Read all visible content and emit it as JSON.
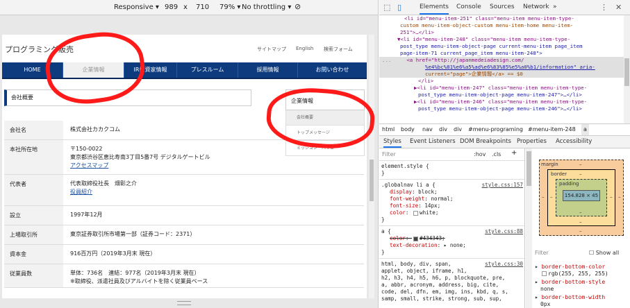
{
  "device_toolbar": {
    "mode": "Responsive",
    "width": "989",
    "times": "x",
    "height": "710",
    "zoom": "79%",
    "throttle": "No throttling"
  },
  "site": {
    "title": "プログラミング販売",
    "util_links": [
      "サイトマップ",
      "English",
      "検索フォーム"
    ],
    "nav": [
      "HOME",
      "企業情報",
      "IR投資家情報",
      "プレスルーム",
      "採用情報",
      "お問い合わせ"
    ],
    "section_heading": "会社概要",
    "side_menu": {
      "heading": "企業情報",
      "items": [
        "会社概要",
        "トップメッセージ",
        "ミッション・バリュー"
      ]
    },
    "table": [
      {
        "label": "会社名",
        "lines": [
          "株式会社カカクコム"
        ],
        "link": ""
      },
      {
        "label": "本社所在地",
        "lines": [
          "〒150-0022",
          "東京都渋谷区恵比寿南3丁目5番7号 デジタルゲートビル"
        ],
        "link": "アクセスマップ"
      },
      {
        "label": "代表者",
        "lines": [
          "代表取締役社長　畑彰之介"
        ],
        "link": "役員紹介"
      },
      {
        "label": "設立",
        "lines": [
          "1997年12月"
        ],
        "link": ""
      },
      {
        "label": "上場取引所",
        "lines": [
          "東京証券取引所市場第一部（証券コード：2371）"
        ],
        "link": ""
      },
      {
        "label": "資本金",
        "lines": [
          "916百万円（2019年3月末 現在）"
        ],
        "link": ""
      },
      {
        "label": "従業員数",
        "lines": [
          "単体：736名　連結：977名（2019年3月末 現在）",
          "※取締役、派遣社員及びアルバイトを除く従業員ベース"
        ],
        "link": ""
      }
    ]
  },
  "devtools": {
    "tabs": [
      "Elements",
      "Console",
      "Sources",
      "Network"
    ],
    "more": "»",
    "elements_lines": [
      "<li id=\"menu-item-251\" class=\"menu-item menu-item-type-",
      "custom menu-item-object-custom menu-item-home menu-item-",
      "251\">…</li>",
      "▼<li id=\"menu-item-248\" class=\"menu-item menu-item-type-",
      "post_type menu-item-object-page current-menu-item page_item",
      "page-item-71 current_page_item menu-item-248\">",
      "<a href=\"http://japanmedeiadesign.com/",
      "%e4%bc%81%e6%a5%ad%e6%83%85%e5%a0%b1/information\" aria-",
      "current=\"page\">企業情報</a> == $0",
      "</li>",
      "▶<li id=\"menu-item-247\" class=\"menu-item menu-item-type-",
      "post_type menu-item-object-page menu-item-247\">…</li>",
      "▶<li id=\"menu-item-246\" class=\"menu-item menu-item-type-",
      "post_type menu-item-object-page menu-item-246\">…</li>"
    ],
    "breadcrumbs": [
      "html",
      "body",
      "nav",
      "div",
      "div",
      "#menu-programing",
      "#menu-item-248",
      "a"
    ],
    "sub_tabs": [
      "Styles",
      "Event Listeners",
      "DOM Breakpoints",
      "Properties",
      "Accessibility"
    ],
    "styles": {
      "filter_placeholder": "Filter",
      "hov": ":hov",
      "cls": ".cls",
      "plus": "+",
      "element_style": "element.style {",
      "close": "}",
      "rule1_selector": ".globalnav li a {",
      "rule1_source": "style.css:157",
      "rule1_props": [
        {
          "name": "display",
          "value": "block;"
        },
        {
          "name": "font-weight",
          "value": "normal;"
        },
        {
          "name": "font-size",
          "value": "14px;"
        },
        {
          "name": "color",
          "value": "white;"
        }
      ],
      "rule2_selector": "a {",
      "rule2_source": "style.css:88",
      "rule2_props": [
        {
          "name": "color",
          "value": "#434343;"
        },
        {
          "name": "text-decoration",
          "value": "▸ none;"
        }
      ],
      "rule3_source": "style.css:30",
      "rule3_lines": [
        "html, body, div, span,",
        "applet, object, iframe, h1,",
        "h2, h3, h4, h5, h6, p, blockquote, pre,",
        "a, abbr, acronym, address, big, cite,",
        "code, del, dfn, em, img, ins, kbd, q, s,",
        "samp, small, strike, strong, sub, sup,"
      ]
    },
    "box_model": {
      "margin": "margin",
      "border": "border",
      "padding": "padding",
      "content": "154.828 × 45",
      "dash": "–"
    },
    "computed": {
      "filter": "Filter",
      "show_all": "Show all",
      "props": [
        {
          "name": "border-bottom-color",
          "value": "rgb(255, 255, 255)"
        },
        {
          "name": "border-bottom-style",
          "value": "none"
        },
        {
          "name": "border-bottom-width",
          "value": "0px"
        }
      ]
    }
  }
}
